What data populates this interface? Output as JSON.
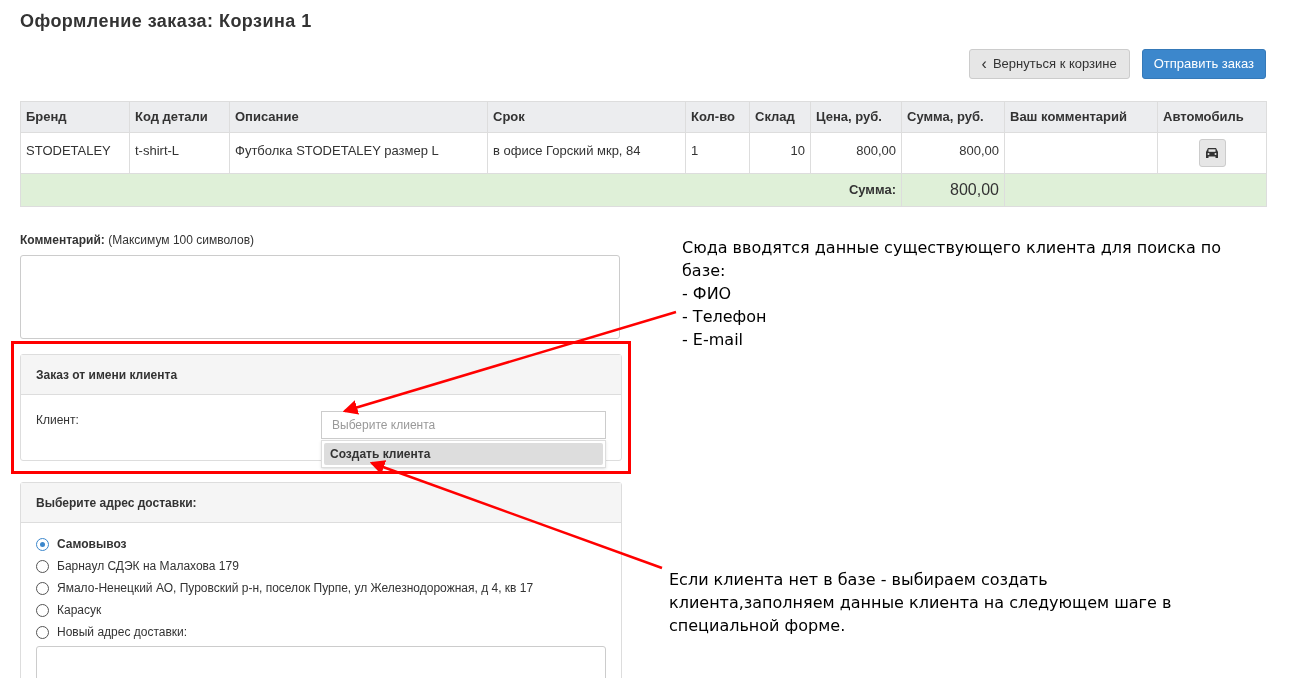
{
  "title": "Оформление заказа: Корзина 1",
  "actions": {
    "back": {
      "icon": "‹",
      "label": "Вернуться к корзине"
    },
    "submit": "Отправить заказ"
  },
  "table": {
    "columns": [
      "Бренд",
      "Код детали",
      "Описание",
      "Срок",
      "Кол-во",
      "Склад",
      "Цена, руб.",
      "Сумма, руб.",
      "Ваш комментарий",
      "Автомобиль"
    ],
    "rows": [
      {
        "cells": [
          "STODETALEY",
          "t-shirt-L",
          "Футболка STODETALEY размер L",
          "в офисе Горский мкр, 84",
          "1",
          "10",
          "800,00",
          "800,00",
          ""
        ],
        "car_button": true
      }
    ],
    "total": {
      "label": "Сумма:",
      "value": "800,00"
    }
  },
  "comment": {
    "label": "Комментарий:",
    "hint": "(Максимум 100 символов)"
  },
  "client_panel": {
    "title": "Заказ от имени клиента",
    "label": "Клиент:",
    "placeholder": "Выберите клиента",
    "options": [
      {
        "label": "Создать клиента",
        "selected": true
      }
    ]
  },
  "address_panel": {
    "title": "Выберите адрес доставки:",
    "options": [
      {
        "label": "Самовывоз",
        "selected": true
      },
      {
        "label": "Барнаул СДЭК на Малахова 179",
        "selected": false
      },
      {
        "label": "Ямало-Ненецкий АО, Пуровский р-н, поселок Пурпе, ул Железнодорожная, д 4, кв 17",
        "selected": false
      },
      {
        "label": "Карасук",
        "selected": false
      },
      {
        "label": "Новый адрес доставки:",
        "selected": false
      }
    ]
  },
  "annotations": [
    {
      "text": "Сюда вводятся данные существующего клиента для поиска по базе:",
      "items": [
        "- ФИО",
        "- Телефон",
        "- E-mail"
      ]
    },
    {
      "text": "Если клиента нет в базе - выбираем создать клиента,заполняем данные клиента на следующем шаге в специальной форме."
    }
  ]
}
